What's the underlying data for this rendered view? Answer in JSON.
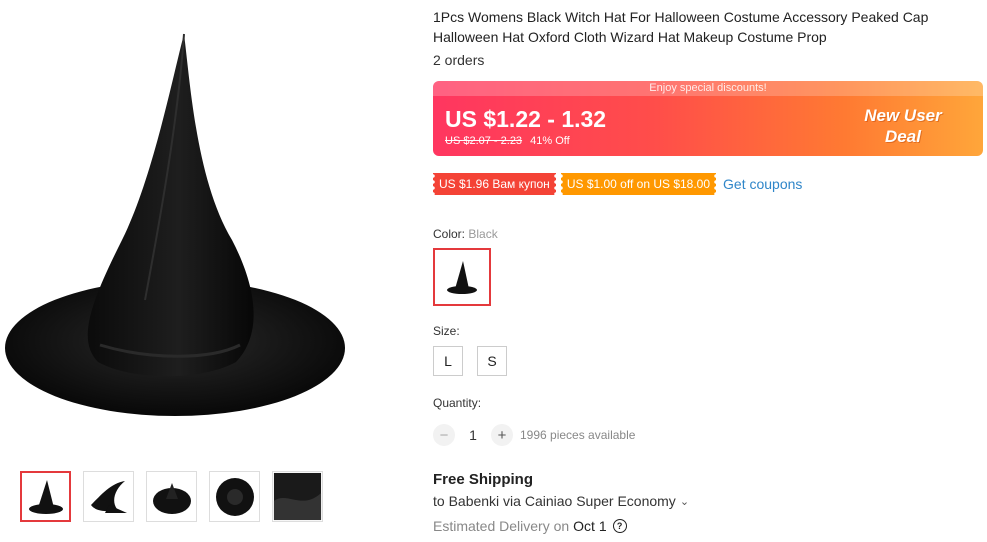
{
  "product": {
    "title": "1Pcs Womens Black Witch Hat For Halloween Costume Accessory Peaked Cap Halloween Hat Oxford Cloth Wizard Hat Makeup Costume Prop",
    "orders": "2 orders",
    "main_image_icon": "witch-hat-image",
    "thumbnails": [
      {
        "icon": "witch-hat-thumbnail",
        "active": true
      },
      {
        "icon": "bent-witch-hat-thumbnail",
        "active": false
      },
      {
        "icon": "hat-top-view-thumbnail",
        "active": false
      },
      {
        "icon": "hat-brim-top-view-thumbnail",
        "active": false
      },
      {
        "icon": "hat-fabric-closeup-thumbnail",
        "active": false
      }
    ]
  },
  "price": {
    "banner": "Enjoy special discounts!",
    "current": "US $1.22 - 1.32",
    "original": "US $2.07 - 2.23",
    "discount": "41% Off",
    "badge_line1": "New User",
    "badge_line2": "Deal"
  },
  "coupons": {
    "coupon1": "US $1.96 Вам купон",
    "coupon2": "US $1.00 off on US $18.00",
    "get_coupons": "Get coupons"
  },
  "color": {
    "label": "Color:",
    "selected": "Black"
  },
  "size": {
    "label": "Size:",
    "options": [
      "L",
      "S"
    ]
  },
  "quantity": {
    "label": "Quantity:",
    "minus": "−",
    "value": "1",
    "plus": "+",
    "available": "1996 pieces available"
  },
  "shipping": {
    "title": "Free Shipping",
    "details": "to Babenki via Cainiao Super Economy",
    "delivery_label": "Estimated Delivery on",
    "delivery_date": "Oct 1"
  },
  "colors": {
    "accent_red": "#e4393c",
    "price_gradient_start": "#ff3660",
    "price_gradient_end": "#ffa63a",
    "link_blue": "#2f86c9",
    "coupon_red": "#f44336",
    "coupon_orange": "#ff9800"
  }
}
